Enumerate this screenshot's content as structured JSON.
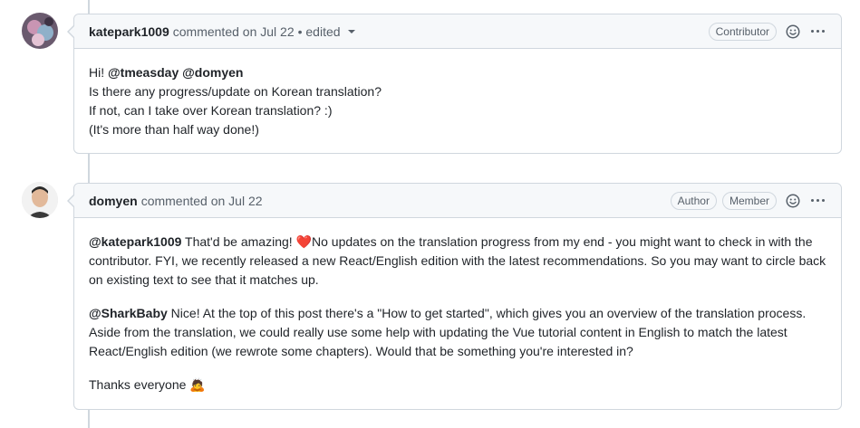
{
  "comments": [
    {
      "author": "katepark1009",
      "meta": "commented on Jul 22",
      "edited": "• edited",
      "badges": [
        "Contributor"
      ],
      "body": {
        "line1_prefix": "Hi! ",
        "mention_a": "@tmeasday",
        "mention_b": "@domyen",
        "line2": "Is there any progress/update on Korean translation?",
        "line3": "If not, can I take over Korean translation? :)",
        "line4": "(It's more than half way done!)"
      }
    },
    {
      "author": "domyen",
      "meta": "commented on Jul 22",
      "badges": [
        "Author",
        "Member"
      ],
      "body": {
        "p1_mention": "@katepark1009",
        "p1_text_a": " That'd be amazing! ",
        "p1_emoji": "❤️",
        "p1_text_b": "No updates on the translation progress from my end - you might want to check in with the contributor. FYI, we recently released a new React/English edition with the latest recommendations. So you may want to circle back on existing text to see that it matches up.",
        "p2_mention": "@SharkBaby",
        "p2_text": " Nice! At the top of this post there's a \"How to get started\", which gives you an overview of the translation process. Aside from the translation, we could really use some help with updating the Vue tutorial content in English to match the latest React/English edition (we rewrote some chapters). Would that be something you're interested in?",
        "p3_text": "Thanks everyone ",
        "p3_emoji": "🙇"
      }
    }
  ],
  "icons": {
    "emoji_react": "smiley-icon",
    "more": "kebab-horizontal-icon",
    "caret": "triangle-down-icon"
  },
  "colors": {
    "border": "#d0d7de",
    "header_bg": "#f6f8fa",
    "muted_text": "#57606a",
    "text": "#1f2328"
  }
}
